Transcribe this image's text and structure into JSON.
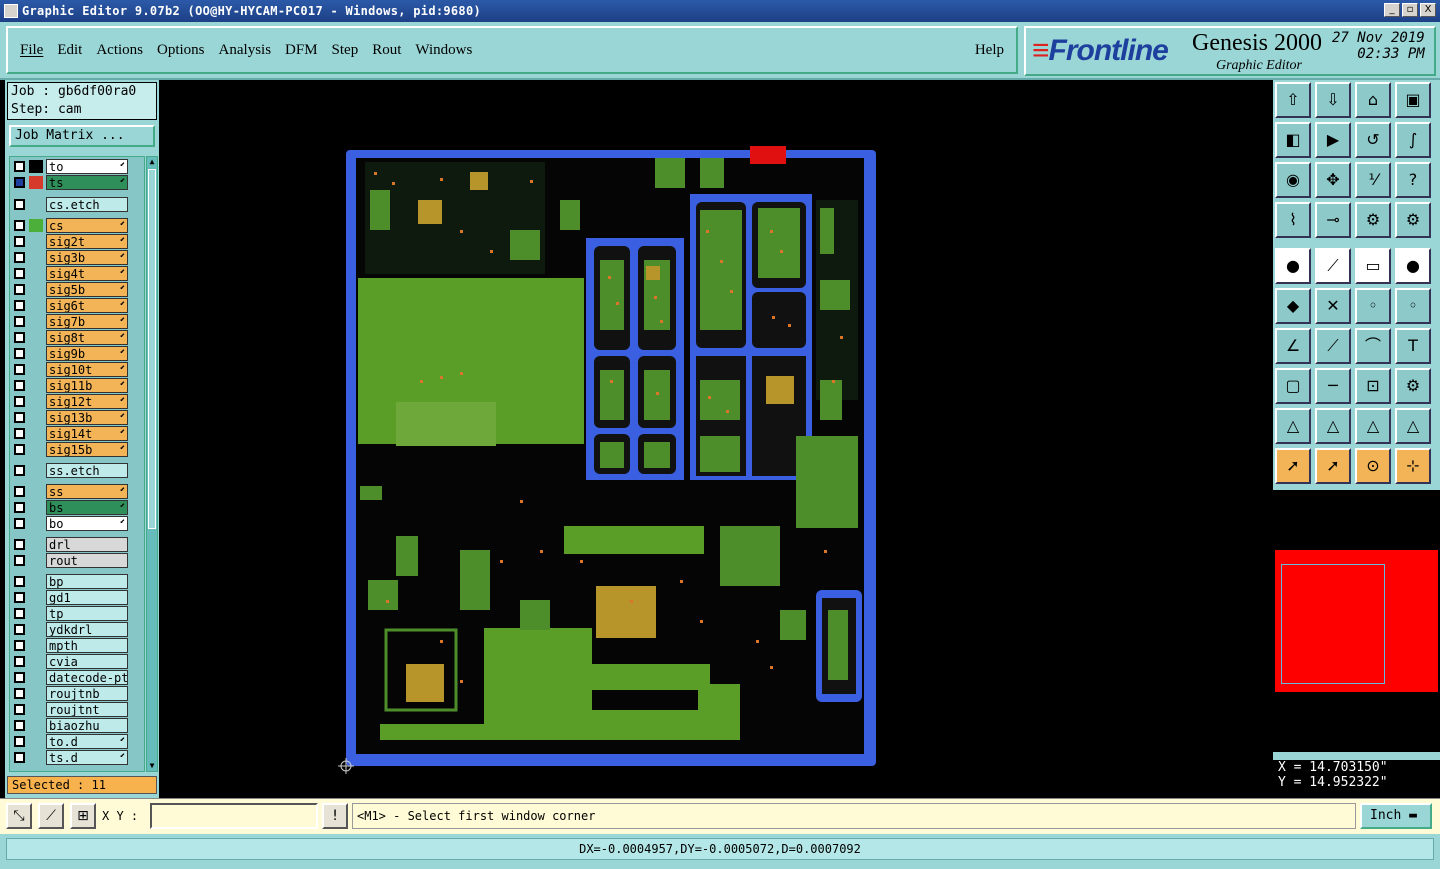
{
  "window": {
    "title": "Graphic Editor 9.07b2 (OO@HY-HYCAM-PC017 - Windows, pid:9680)",
    "controls": [
      "_",
      "▫",
      "X"
    ]
  },
  "menu": {
    "items": [
      "File",
      "Edit",
      "Actions",
      "Options",
      "Analysis",
      "DFM",
      "Step",
      "Rout",
      "Windows"
    ],
    "help": "Help"
  },
  "brand": {
    "logo": "Frontline",
    "product": "Genesis 2000",
    "subtitle": "Graphic Editor",
    "date": "27 Nov 2019",
    "time": "02:33 PM"
  },
  "job": {
    "job_label": "Job : gb6df00ra0",
    "step_label": "Step: cam",
    "matrix_button": "Job Matrix ..."
  },
  "layers": [
    {
      "name": "to",
      "color": "#ffffff",
      "swatch": "#000000",
      "arrow": true
    },
    {
      "name": "ts",
      "color": "#2f8f5a",
      "swatch": "#d63a2a",
      "arrow": true,
      "selected": true
    },
    {
      "name": "cs.etch",
      "color": "#bfeaea",
      "swatch": "",
      "arrow": false
    },
    {
      "name": "cs",
      "color": "#f2b457",
      "swatch": "#4caf3a",
      "arrow": true
    },
    {
      "name": "sig2t",
      "color": "#f2b457",
      "swatch": "",
      "arrow": true
    },
    {
      "name": "sig3b",
      "color": "#f2b457",
      "swatch": "",
      "arrow": true
    },
    {
      "name": "sig4t",
      "color": "#f2b457",
      "swatch": "",
      "arrow": true
    },
    {
      "name": "sig5b",
      "color": "#f2b457",
      "swatch": "",
      "arrow": true
    },
    {
      "name": "sig6t",
      "color": "#f2b457",
      "swatch": "",
      "arrow": true
    },
    {
      "name": "sig7b",
      "color": "#f2b457",
      "swatch": "",
      "arrow": true
    },
    {
      "name": "sig8t",
      "color": "#f2b457",
      "swatch": "",
      "arrow": true
    },
    {
      "name": "sig9b",
      "color": "#f2b457",
      "swatch": "",
      "arrow": true
    },
    {
      "name": "sig10t",
      "color": "#f2b457",
      "swatch": "",
      "arrow": true
    },
    {
      "name": "sig11b",
      "color": "#f2b457",
      "swatch": "",
      "arrow": true
    },
    {
      "name": "sig12t",
      "color": "#f2b457",
      "swatch": "",
      "arrow": true
    },
    {
      "name": "sig13b",
      "color": "#f2b457",
      "swatch": "",
      "arrow": true
    },
    {
      "name": "sig14t",
      "color": "#f2b457",
      "swatch": "",
      "arrow": true
    },
    {
      "name": "sig15b",
      "color": "#f2b457",
      "swatch": "",
      "arrow": true
    },
    {
      "name": "ss.etch",
      "color": "#bfeaea",
      "swatch": "",
      "arrow": false
    },
    {
      "name": "ss",
      "color": "#f2b457",
      "swatch": "",
      "arrow": true
    },
    {
      "name": "bs",
      "color": "#2f8f5a",
      "swatch": "",
      "arrow": true
    },
    {
      "name": "bo",
      "color": "#ffffff",
      "swatch": "",
      "arrow": true
    },
    {
      "name": "drl",
      "color": "#d8d8d8",
      "swatch": "",
      "arrow": false
    },
    {
      "name": "rout",
      "color": "#d8d8d8",
      "swatch": "",
      "arrow": false
    },
    {
      "name": "bp",
      "color": "#bfeaea",
      "swatch": "",
      "arrow": false
    },
    {
      "name": "gd1",
      "color": "#bfeaea",
      "swatch": "",
      "arrow": false
    },
    {
      "name": "tp",
      "color": "#bfeaea",
      "swatch": "",
      "arrow": false
    },
    {
      "name": "ydkdrl",
      "color": "#bfeaea",
      "swatch": "",
      "arrow": false
    },
    {
      "name": "mpth",
      "color": "#bfeaea",
      "swatch": "",
      "arrow": false
    },
    {
      "name": "cvia",
      "color": "#bfeaea",
      "swatch": "",
      "arrow": false
    },
    {
      "name": "datecode-pto",
      "color": "#bfeaea",
      "swatch": "",
      "arrow": false
    },
    {
      "name": "roujtnb",
      "color": "#bfeaea",
      "swatch": "",
      "arrow": false
    },
    {
      "name": "roujtnt",
      "color": "#bfeaea",
      "swatch": "",
      "arrow": false
    },
    {
      "name": "biaozhu",
      "color": "#bfeaea",
      "swatch": "",
      "arrow": false
    },
    {
      "name": "to.d",
      "color": "#bfeaea",
      "swatch": "",
      "arrow": true
    },
    {
      "name": "ts.d",
      "color": "#bfeaea",
      "swatch": "",
      "arrow": true
    }
  ],
  "selected_count": "Selected : 11",
  "toolbar_icons": [
    "home-icon",
    "zoom-home-icon",
    "house-icon",
    "window-icon",
    "pan-left-icon",
    "pan-right-icon",
    "pan-center-icon",
    "s-shape-icon",
    "zoom-fit-icon",
    "zoom-center-icon",
    "ratio-icon",
    "help-icon",
    "measure-icon",
    "snap-icon",
    "layer-toggle-icon",
    "layer-toggle2-icon",
    "pad-icon",
    "line-icon",
    "ruler-icon",
    "circle-icon",
    "connect-icon",
    "cross-icon",
    "node-icon",
    "node2-icon",
    "angle-icon",
    "diag-icon",
    "arc-icon",
    "text-icon",
    "rect-icon",
    "minus-icon",
    "frame-icon",
    "gear-icon",
    "tri-icon",
    "tri2-icon",
    "tri3-icon",
    "tri4-icon",
    "pointer-icon",
    "pointer2-icon",
    "pointer3-icon",
    "pointer4-icon"
  ],
  "coords": {
    "x": "X = 14.703150\"",
    "y": "Y = 14.952322\""
  },
  "bottom": {
    "xy_label": "X Y :",
    "xy_value": "",
    "prompt": "<M1> - Select first window corner",
    "units": "Inch",
    "status": "DX=-0.0004957,DY=-0.0005072,D=0.0007092"
  }
}
